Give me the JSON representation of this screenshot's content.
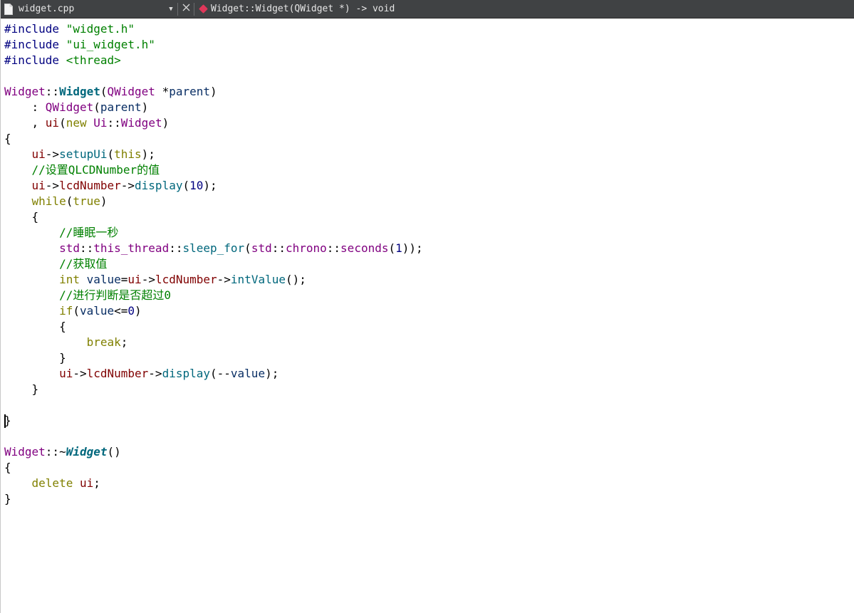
{
  "toolbar": {
    "file_name": "widget.cpp",
    "symbol": "Widget::Widget(QWidget *) -> void",
    "icons": {
      "file": "file-icon",
      "dropdown": "chevron-down-icon",
      "close": "close-icon",
      "symbol": "method-icon"
    }
  },
  "editor": {
    "lines": [
      [
        {
          "t": "#include ",
          "c": "t-pre"
        },
        {
          "t": "\"widget.h\"",
          "c": "t-str"
        }
      ],
      [
        {
          "t": "#include ",
          "c": "t-pre"
        },
        {
          "t": "\"ui_widget.h\"",
          "c": "t-str"
        }
      ],
      [
        {
          "t": "#include ",
          "c": "t-pre"
        },
        {
          "t": "<thread>",
          "c": "t-str"
        }
      ],
      [],
      [
        {
          "t": "Widget",
          "c": "t-type"
        },
        {
          "t": "::",
          "c": "t-op"
        },
        {
          "t": "Widget",
          "c": "t-fn-b"
        },
        {
          "t": "(",
          "c": "t-op"
        },
        {
          "t": "QWidget",
          "c": "t-type"
        },
        {
          "t": " *",
          "c": "t-op"
        },
        {
          "t": "parent",
          "c": "t-param"
        },
        {
          "t": ")",
          "c": "t-op"
        }
      ],
      [
        {
          "t": "    : ",
          "c": "t-op"
        },
        {
          "t": "QWidget",
          "c": "t-type"
        },
        {
          "t": "(",
          "c": "t-op"
        },
        {
          "t": "parent",
          "c": "t-param"
        },
        {
          "t": ")",
          "c": "t-op"
        }
      ],
      [
        {
          "t": "    , ",
          "c": "t-op"
        },
        {
          "t": "ui",
          "c": "t-field"
        },
        {
          "t": "(",
          "c": "t-op"
        },
        {
          "t": "new",
          "c": "t-kw"
        },
        {
          "t": " ",
          "c": "t-op"
        },
        {
          "t": "Ui",
          "c": "t-ns"
        },
        {
          "t": "::",
          "c": "t-op"
        },
        {
          "t": "Widget",
          "c": "t-type"
        },
        {
          "t": ")",
          "c": "t-op"
        }
      ],
      [
        {
          "t": "{",
          "c": "t-op"
        }
      ],
      [
        {
          "t": "    ",
          "c": "t-op"
        },
        {
          "t": "ui",
          "c": "t-field"
        },
        {
          "t": "->",
          "c": "t-op"
        },
        {
          "t": "setupUi",
          "c": "t-fn"
        },
        {
          "t": "(",
          "c": "t-op"
        },
        {
          "t": "this",
          "c": "t-kw"
        },
        {
          "t": ");",
          "c": "t-op"
        }
      ],
      [
        {
          "t": "    ",
          "c": "t-op"
        },
        {
          "t": "//设置QLCDNumber的值",
          "c": "t-cmt"
        }
      ],
      [
        {
          "t": "    ",
          "c": "t-op"
        },
        {
          "t": "ui",
          "c": "t-field"
        },
        {
          "t": "->",
          "c": "t-op"
        },
        {
          "t": "lcdNumber",
          "c": "t-field"
        },
        {
          "t": "->",
          "c": "t-op"
        },
        {
          "t": "display",
          "c": "t-fn"
        },
        {
          "t": "(",
          "c": "t-op"
        },
        {
          "t": "10",
          "c": "t-num"
        },
        {
          "t": ");",
          "c": "t-op"
        }
      ],
      [
        {
          "t": "    ",
          "c": "t-op"
        },
        {
          "t": "while",
          "c": "t-kw"
        },
        {
          "t": "(",
          "c": "t-op"
        },
        {
          "t": "true",
          "c": "t-kw"
        },
        {
          "t": ")",
          "c": "t-op"
        }
      ],
      [
        {
          "t": "    {",
          "c": "t-op"
        }
      ],
      [
        {
          "t": "        ",
          "c": "t-op"
        },
        {
          "t": "//睡眠一秒",
          "c": "t-cmt"
        }
      ],
      [
        {
          "t": "        ",
          "c": "t-op"
        },
        {
          "t": "std",
          "c": "t-ns"
        },
        {
          "t": "::",
          "c": "t-op"
        },
        {
          "t": "this_thread",
          "c": "t-ns"
        },
        {
          "t": "::",
          "c": "t-op"
        },
        {
          "t": "sleep_for",
          "c": "t-fn"
        },
        {
          "t": "(",
          "c": "t-op"
        },
        {
          "t": "std",
          "c": "t-ns"
        },
        {
          "t": "::",
          "c": "t-op"
        },
        {
          "t": "chrono",
          "c": "t-ns"
        },
        {
          "t": "::",
          "c": "t-op"
        },
        {
          "t": "seconds",
          "c": "t-type"
        },
        {
          "t": "(",
          "c": "t-op"
        },
        {
          "t": "1",
          "c": "t-num"
        },
        {
          "t": "));",
          "c": "t-op"
        }
      ],
      [
        {
          "t": "        ",
          "c": "t-op"
        },
        {
          "t": "//获取值",
          "c": "t-cmt"
        }
      ],
      [
        {
          "t": "        ",
          "c": "t-op"
        },
        {
          "t": "int",
          "c": "t-kw"
        },
        {
          "t": " ",
          "c": "t-op"
        },
        {
          "t": "value",
          "c": "t-param"
        },
        {
          "t": "=",
          "c": "t-op"
        },
        {
          "t": "ui",
          "c": "t-field"
        },
        {
          "t": "->",
          "c": "t-op"
        },
        {
          "t": "lcdNumber",
          "c": "t-field"
        },
        {
          "t": "->",
          "c": "t-op"
        },
        {
          "t": "intValue",
          "c": "t-fn"
        },
        {
          "t": "();",
          "c": "t-op"
        }
      ],
      [
        {
          "t": "        ",
          "c": "t-op"
        },
        {
          "t": "//进行判断是否超过0",
          "c": "t-cmt"
        }
      ],
      [
        {
          "t": "        ",
          "c": "t-op"
        },
        {
          "t": "if",
          "c": "t-kw"
        },
        {
          "t": "(",
          "c": "t-op"
        },
        {
          "t": "value",
          "c": "t-param"
        },
        {
          "t": "<=",
          "c": "t-op"
        },
        {
          "t": "0",
          "c": "t-num"
        },
        {
          "t": ")",
          "c": "t-op"
        }
      ],
      [
        {
          "t": "        {",
          "c": "t-op"
        }
      ],
      [
        {
          "t": "            ",
          "c": "t-op"
        },
        {
          "t": "break",
          "c": "t-kw"
        },
        {
          "t": ";",
          "c": "t-op"
        }
      ],
      [
        {
          "t": "        }",
          "c": "t-op"
        }
      ],
      [
        {
          "t": "        ",
          "c": "t-op"
        },
        {
          "t": "ui",
          "c": "t-field"
        },
        {
          "t": "->",
          "c": "t-op"
        },
        {
          "t": "lcdNumber",
          "c": "t-field"
        },
        {
          "t": "->",
          "c": "t-op"
        },
        {
          "t": "display",
          "c": "t-fn"
        },
        {
          "t": "(--",
          "c": "t-op"
        },
        {
          "t": "value",
          "c": "t-param"
        },
        {
          "t": ");",
          "c": "t-op"
        }
      ],
      [
        {
          "t": "    }",
          "c": "t-op"
        }
      ],
      [],
      [
        {
          "t": "}",
          "c": "t-op"
        }
      ],
      [],
      [
        {
          "t": "Widget",
          "c": "t-type"
        },
        {
          "t": "::~",
          "c": "t-op"
        },
        {
          "t": "Widget",
          "c": "t-fn-bi"
        },
        {
          "t": "()",
          "c": "t-op"
        }
      ],
      [
        {
          "t": "{",
          "c": "t-op"
        }
      ],
      [
        {
          "t": "    ",
          "c": "t-op"
        },
        {
          "t": "delete",
          "c": "t-kw"
        },
        {
          "t": " ",
          "c": "t-op"
        },
        {
          "t": "ui",
          "c": "t-field"
        },
        {
          "t": ";",
          "c": "t-op"
        }
      ],
      [
        {
          "t": "}",
          "c": "t-op"
        }
      ]
    ],
    "cursor_line": 25
  }
}
